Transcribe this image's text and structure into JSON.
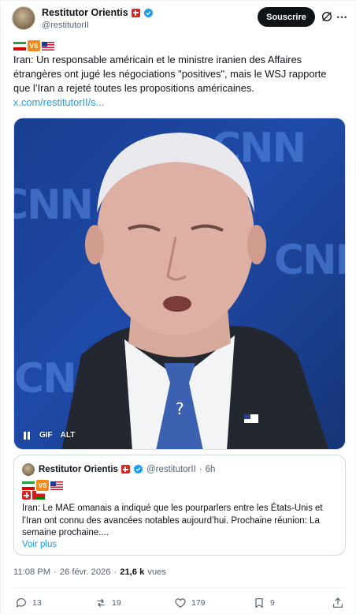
{
  "author": {
    "name": "Restitutor Orientis",
    "handle": "@restitutorII",
    "subscribe_label": "Souscrire"
  },
  "tweet": {
    "vs_label": "VS",
    "text": "Iran: Un responsable américain et le ministre iranien des Affaires étrangères ont jugé les négociations \"positives\", mais le WSJ rapporte que l’Iran a rejeté toutes les propositions américaines.",
    "link": "x.com/restitutorII/s..."
  },
  "media": {
    "watermark": "CNN",
    "controls": {
      "gif": "GIF",
      "alt": "ALT"
    }
  },
  "quote": {
    "name": "Restitutor Orientis",
    "handle": "@restitutorII",
    "separator": "·",
    "time": "6h",
    "vs_label": "VS",
    "text": "Iran: Le MAE omanais a indiqué que les pourparlers entre les États-Unis et l’Iran ont connu des avancées notables aujourd’hui. Prochaine réunion: La semaine prochaine....",
    "more": "Voir plus"
  },
  "meta": {
    "time": "11:08 PM",
    "separator": "·",
    "date": "26 févr. 2026",
    "separator2": "·",
    "views_count": "21,6 k",
    "views_label": "vues"
  },
  "actions": {
    "replies": "13",
    "reposts": "19",
    "likes": "179",
    "bookmarks": "9"
  },
  "colors": {
    "accent": "#1d9bf0",
    "text": "#0f1419",
    "muted": "#536471"
  }
}
